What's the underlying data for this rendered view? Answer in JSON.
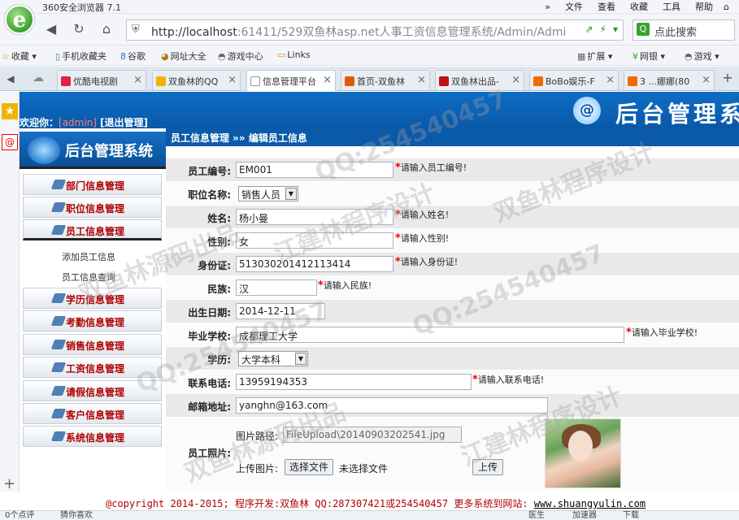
{
  "browser": {
    "app_title": "360安全浏览器 7.1",
    "logo_letter": "e",
    "menu": [
      "文件",
      "查看",
      "收藏",
      "工具",
      "帮助"
    ],
    "url_host": "http://localhost",
    "url_rest": ":61411/529双鱼林asp.net人事工资信息管理系统/Admin/Admi",
    "search_placeholder": "点此搜索",
    "bookmarks": [
      "收藏",
      "手机收藏夹",
      "谷歌",
      "网址大全",
      "游戏中心",
      "Links",
      "扩展",
      "网银",
      "游戏"
    ],
    "tabs": [
      "优酷电视剧",
      "双鱼林的QQ",
      "信息管理平台",
      "首页-双鱼林",
      "双鱼林出品-",
      "BoBo娱乐-F",
      "3 ...娜娜(80"
    ],
    "status_left": "0个点评",
    "status_mid": "猜你喜欢",
    "status_right": [
      "医生",
      "加速器",
      "下载"
    ]
  },
  "header": {
    "banner_title": "后台管理系",
    "welcome_prefix": "欢迎你：",
    "username": "[admin]",
    "logout": "[退出管理]"
  },
  "sidebar": {
    "title": "后台管理系统",
    "items": [
      {
        "label": "部门信息管理"
      },
      {
        "label": "职位信息管理"
      },
      {
        "label": "员工信息管理"
      },
      {
        "label": "学历信息管理"
      },
      {
        "label": "考勤信息管理"
      },
      {
        "label": "销售信息管理"
      },
      {
        "label": "工资信息管理"
      },
      {
        "label": "请假信息管理"
      },
      {
        "label": "客户信息管理"
      },
      {
        "label": "系统信息管理"
      }
    ],
    "sub_items": [
      "添加员工信息",
      "员工信息查询"
    ]
  },
  "content": {
    "breadcrumb": "员工信息管理 »» 编辑员工信息",
    "fields": {
      "emp_no": {
        "label": "员工编号:",
        "value": "EM001",
        "hint": "请输入员工编号!"
      },
      "position": {
        "label": "职位名称:",
        "value": "销售人员"
      },
      "name": {
        "label": "姓名:",
        "value": "杨小曼",
        "hint": "请输入姓名!"
      },
      "sex": {
        "label": "性别:",
        "value": "女",
        "hint": "请输入性别!"
      },
      "id_card": {
        "label": "身份证:",
        "value": "513030201412113414",
        "hint": "请输入身份证!"
      },
      "nation": {
        "label": "民族:",
        "value": "汉",
        "hint": "请输入民族!"
      },
      "birthday": {
        "label": "出生日期:",
        "value": "2014-12-11"
      },
      "school": {
        "label": "毕业学校:",
        "value": "成都理工大学",
        "hint": "请输入毕业学校!"
      },
      "education": {
        "label": "学历:",
        "value": "大学本科"
      },
      "phone": {
        "label": "联系电话:",
        "value": "13959194353",
        "hint": "请输入联系电话!"
      },
      "email": {
        "label": "邮箱地址:",
        "value": "yanghn@163.com"
      },
      "photo": {
        "label": "员工照片:",
        "path_label": "图片路径:",
        "path_value": "FileUpload\\20140903202541.jpg",
        "upload_label": "上传图片:",
        "choose_file": "选择文件",
        "no_file": "未选择文件",
        "upload_button": "上传"
      }
    }
  },
  "footer": {
    "copyright": "@copyright 2014-2015; 程序开发:双鱼林  QQ:287307421或254540457  更多系统到网站: ",
    "site": "www.shuangyulin.com"
  },
  "watermarks": [
    "QQ:254540457",
    "双鱼林程序设计",
    "双鱼林源码出品",
    "江建林程序设计",
    "QQ:254540457",
    "双鱼林源码出品",
    "QQ:254540457",
    "江建林程序设计"
  ]
}
